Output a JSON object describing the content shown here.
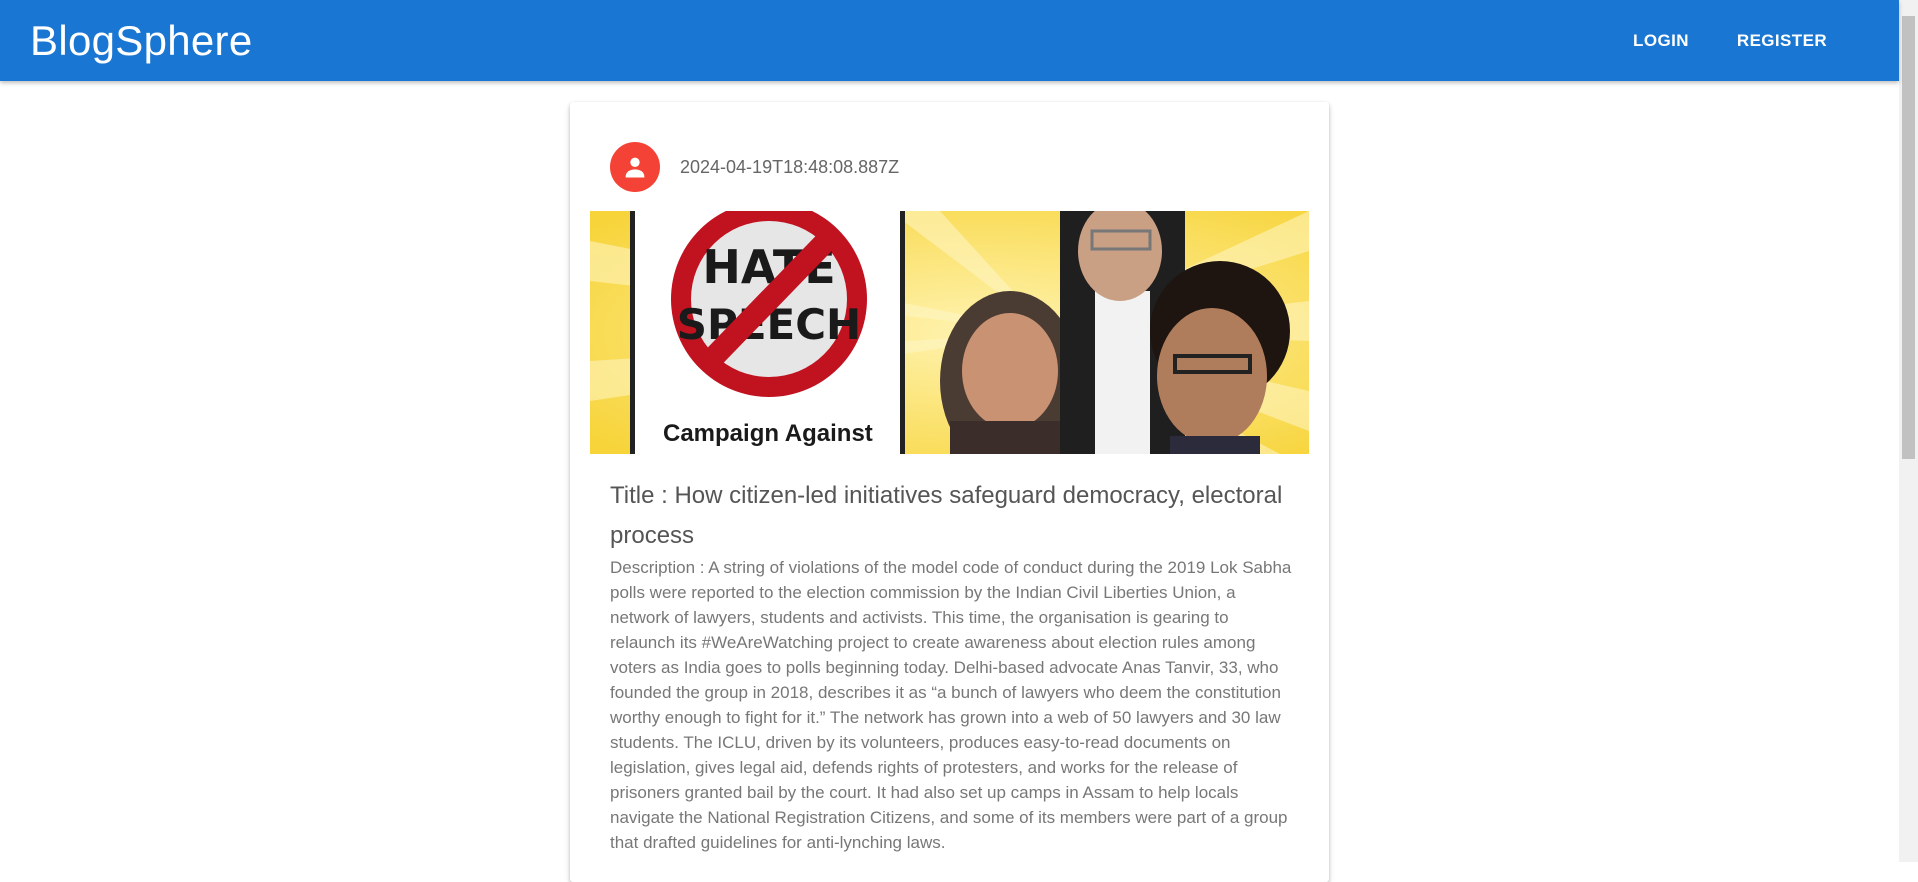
{
  "appbar": {
    "brand": "BlogSphere",
    "nav": {
      "login_label": "LOGIN",
      "register_label": "REGISTER"
    },
    "color": "#1976d2"
  },
  "post": {
    "avatar_icon": "person-icon",
    "avatar_color": "#f44336",
    "timestamp": "2024-04-19T18:48:08.887Z",
    "image": {
      "sign_text": "HATE SPEECH",
      "caption": "Campaign Against"
    },
    "title": "Title : How citizen-led initiatives safeguard democracy, electoral process",
    "description": "Description : A string of violations of the model code of conduct during the 2019 Lok Sabha polls were reported to the election commission by the Indian Civil Liberties Union, a network of lawyers, students and activists. This time, the organisation is gearing to relaunch its #WeAreWatching project to create awareness about election rules among voters as India goes to polls beginning today. Delhi-based advocate Anas Tanvir, 33, who founded the group in 2018, describes it as “a bunch of lawyers who deem the constitution worthy enough to fight for it.” The network has grown into a web of 50 lawyers and 30 law students. The ICLU, driven by its volunteers, produces easy-to-read documents on legislation, gives legal aid, defends rights of protesters, and works for the release of prisoners granted bail by the court. It had also set up camps in Assam to help locals navigate the National Registration Citizens, and some of its members were part of a group that drafted guidelines for anti-lynching laws."
  }
}
